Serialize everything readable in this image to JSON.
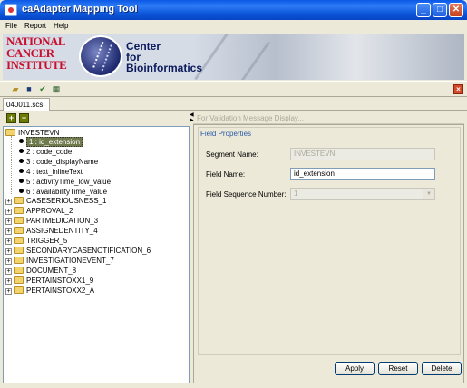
{
  "window": {
    "title": "caAdapter Mapping Tool",
    "minimize": "_",
    "maximize": "□",
    "close": "✕"
  },
  "menu": {
    "file": "File",
    "report": "Report",
    "help": "Help"
  },
  "banner": {
    "nci_line1": "NATIONAL",
    "nci_line2": "CANCER",
    "nci_line3": "INSTITUTE",
    "cfb_line1": "Center",
    "cfb_line2": "for",
    "cfb_line3": "Bioinformatics"
  },
  "toolbar": {
    "close": "×",
    "icons": [
      "open-folder-icon",
      "save-icon",
      "validate-icon",
      "report-icon"
    ]
  },
  "document_tab": {
    "label": "040011.scs"
  },
  "left_toolbar": {
    "expand": "+",
    "collapse": "−"
  },
  "tree": {
    "root": "INVESTEVN",
    "fields": [
      "1 : id_extension",
      "2 : code_code",
      "3 : code_displayName",
      "4 : text_inlineText",
      "5 : activityTime_low_value",
      "6 : availabilityTime_value"
    ],
    "segments": [
      "CASESERIOUSNESS_1",
      "APPROVAL_2",
      "PARTMEDICATION_3",
      "ASSIGNEDENTITY_4",
      "TRIGGER_5",
      "SECONDARYCASENOTIFICATION_6",
      "INVESTIGATIONEVENT_7",
      "DOCUMENT_8",
      "PERTAINSTOXX1_9",
      "PERTAINSTOXX2_A"
    ]
  },
  "validation": {
    "placeholder": "For Validation Message Display..."
  },
  "field_properties": {
    "title": "Field Properties",
    "segment_name_label": "Segment Name:",
    "segment_name_value": "INVESTEVN",
    "field_name_label": "Field Name:",
    "field_name_value": "id_extension",
    "field_seq_label": "Field Sequence Number:",
    "field_seq_value": "1"
  },
  "buttons": {
    "apply": "Apply",
    "reset": "Reset",
    "delete": "Delete"
  }
}
